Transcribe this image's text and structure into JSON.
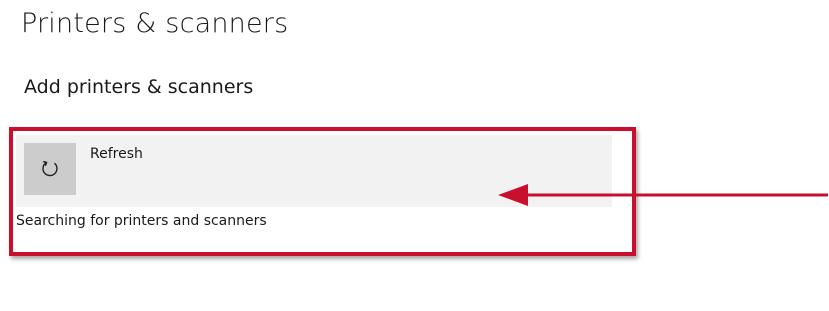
{
  "page": {
    "title": "Printers & scanners"
  },
  "section": {
    "title": "Add printers & scanners"
  },
  "refresh": {
    "label": "Refresh",
    "icon": "refresh-icon"
  },
  "status": {
    "text": "Searching for printers and scanners"
  },
  "annotation": {
    "highlight_color": "#c8102e",
    "arrow_color": "#c8102e"
  },
  "colors": {
    "row_background": "#f2f2f2",
    "icon_box_background": "#cccccc"
  }
}
